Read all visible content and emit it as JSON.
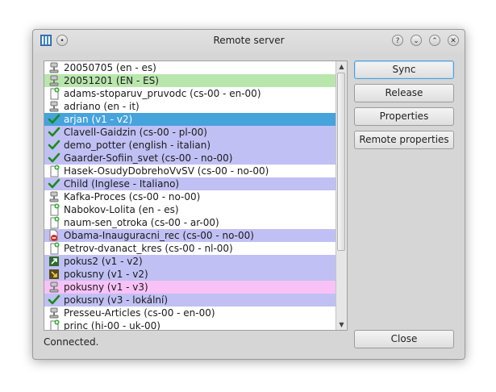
{
  "window": {
    "title": "Remote server"
  },
  "buttons": {
    "sync": "Sync",
    "release": "Release",
    "properties": "Properties",
    "remote_properties": "Remote properties",
    "close": "Close"
  },
  "status": "Connected.",
  "colors": {
    "row_green": "#b9e6ad",
    "row_blue": "#c0c0f4",
    "row_pink": "#f8c2f6",
    "row_selected": "#46a3dc"
  },
  "items": [
    {
      "label": "20050705 (en - es)",
      "icon": "server-icon",
      "highlight": "none"
    },
    {
      "label": "20051201 (EN - ES)",
      "icon": "server-icon",
      "highlight": "green"
    },
    {
      "label": "adams-stoparuv_pruvodc (cs-00 - en-00)",
      "icon": "new-document-icon",
      "highlight": "none"
    },
    {
      "label": "adriano (en - it)",
      "icon": "server-icon",
      "highlight": "none"
    },
    {
      "label": "arjan (v1 - v2)",
      "icon": "check-icon",
      "highlight": "selected"
    },
    {
      "label": "Clavell-Gaidzin (cs-00 - pl-00)",
      "icon": "check-icon",
      "highlight": "blue"
    },
    {
      "label": "demo_potter (english - italian)",
      "icon": "check-icon",
      "highlight": "blue"
    },
    {
      "label": "Gaarder-Sofiin_svet (cs-00 - no-00)",
      "icon": "check-icon",
      "highlight": "blue"
    },
    {
      "label": "Hasek-OsudyDobrehoVvSV (cs-00 - no-00)",
      "icon": "new-document-icon",
      "highlight": "none"
    },
    {
      "label": "Child (Inglese - Italiano)",
      "icon": "check-icon",
      "highlight": "blue"
    },
    {
      "label": "Kafka-Proces (cs-00 - no-00)",
      "icon": "server-icon",
      "highlight": "none"
    },
    {
      "label": "Nabokov-Lolita (en - es)",
      "icon": "new-document-icon",
      "highlight": "none"
    },
    {
      "label": "naum-sen_otroka (cs-00 - ar-00)",
      "icon": "new-document-icon",
      "highlight": "none"
    },
    {
      "label": "Obama-Inauguracni_rec (cs-00 - no-00)",
      "icon": "error-document-icon",
      "highlight": "blue"
    },
    {
      "label": "Petrov-dvanact_kres (cs-00 - nl-00)",
      "icon": "new-document-icon",
      "highlight": "none"
    },
    {
      "label": "pokus2 (v1 - v2)",
      "icon": "upload-icon",
      "highlight": "blue"
    },
    {
      "label": "pokusny (v1 - v2)",
      "icon": "download-icon",
      "highlight": "blue"
    },
    {
      "label": "pokusny (v1 - v3)",
      "icon": "server-icon",
      "highlight": "pink"
    },
    {
      "label": "pokusny (v3 - lokální)",
      "icon": "check-icon",
      "highlight": "blue"
    },
    {
      "label": "Presseu-Articles (cs-00 - en-00)",
      "icon": "server-icon",
      "highlight": "none"
    },
    {
      "label": "princ (hi-00 - uk-00)",
      "icon": "new-document-icon",
      "highlight": "none"
    }
  ]
}
